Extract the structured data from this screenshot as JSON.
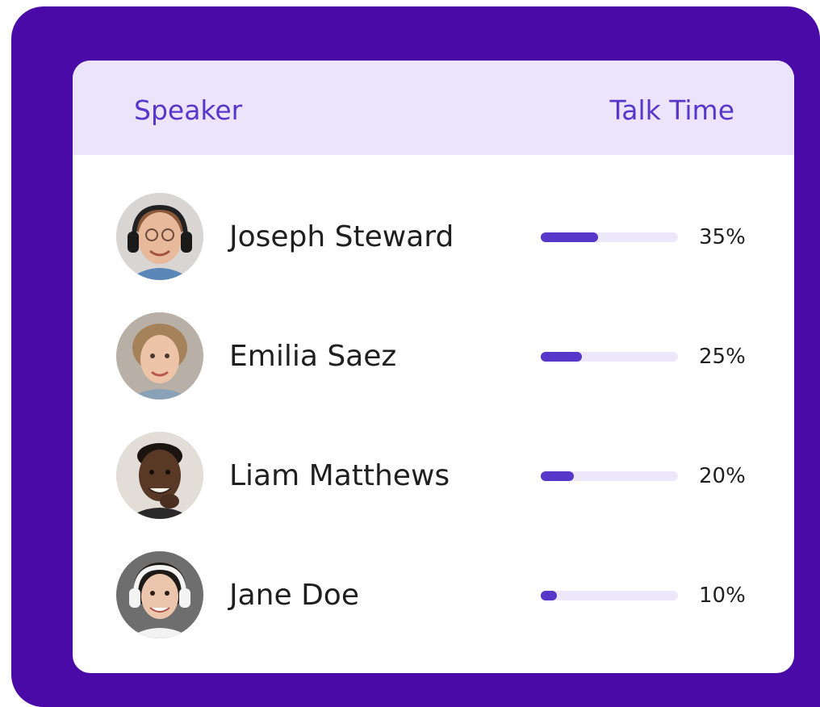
{
  "colors": {
    "frame": "#4a0aa8",
    "header_bg": "#ebe4fb",
    "accent": "#5737c9",
    "track": "#ece8fa",
    "text": "#1f1f1f"
  },
  "header": {
    "speaker_label": "Speaker",
    "talk_time_label": "Talk Time"
  },
  "speakers": [
    {
      "name": "Joseph Steward",
      "talk_time_label": "35%",
      "talk_time": 0.35,
      "avatar_icon": "man-with-headset-avatar"
    },
    {
      "name": "Emilia Saez",
      "talk_time_label": "25%",
      "talk_time": 0.25,
      "avatar_icon": "woman-avatar"
    },
    {
      "name": "Liam Matthews",
      "talk_time_label": "20%",
      "talk_time": 0.2,
      "avatar_icon": "man-avatar"
    },
    {
      "name": "Jane Doe",
      "talk_time_label": "10%",
      "talk_time": 0.1,
      "avatar_icon": "woman-with-headset-avatar"
    }
  ]
}
